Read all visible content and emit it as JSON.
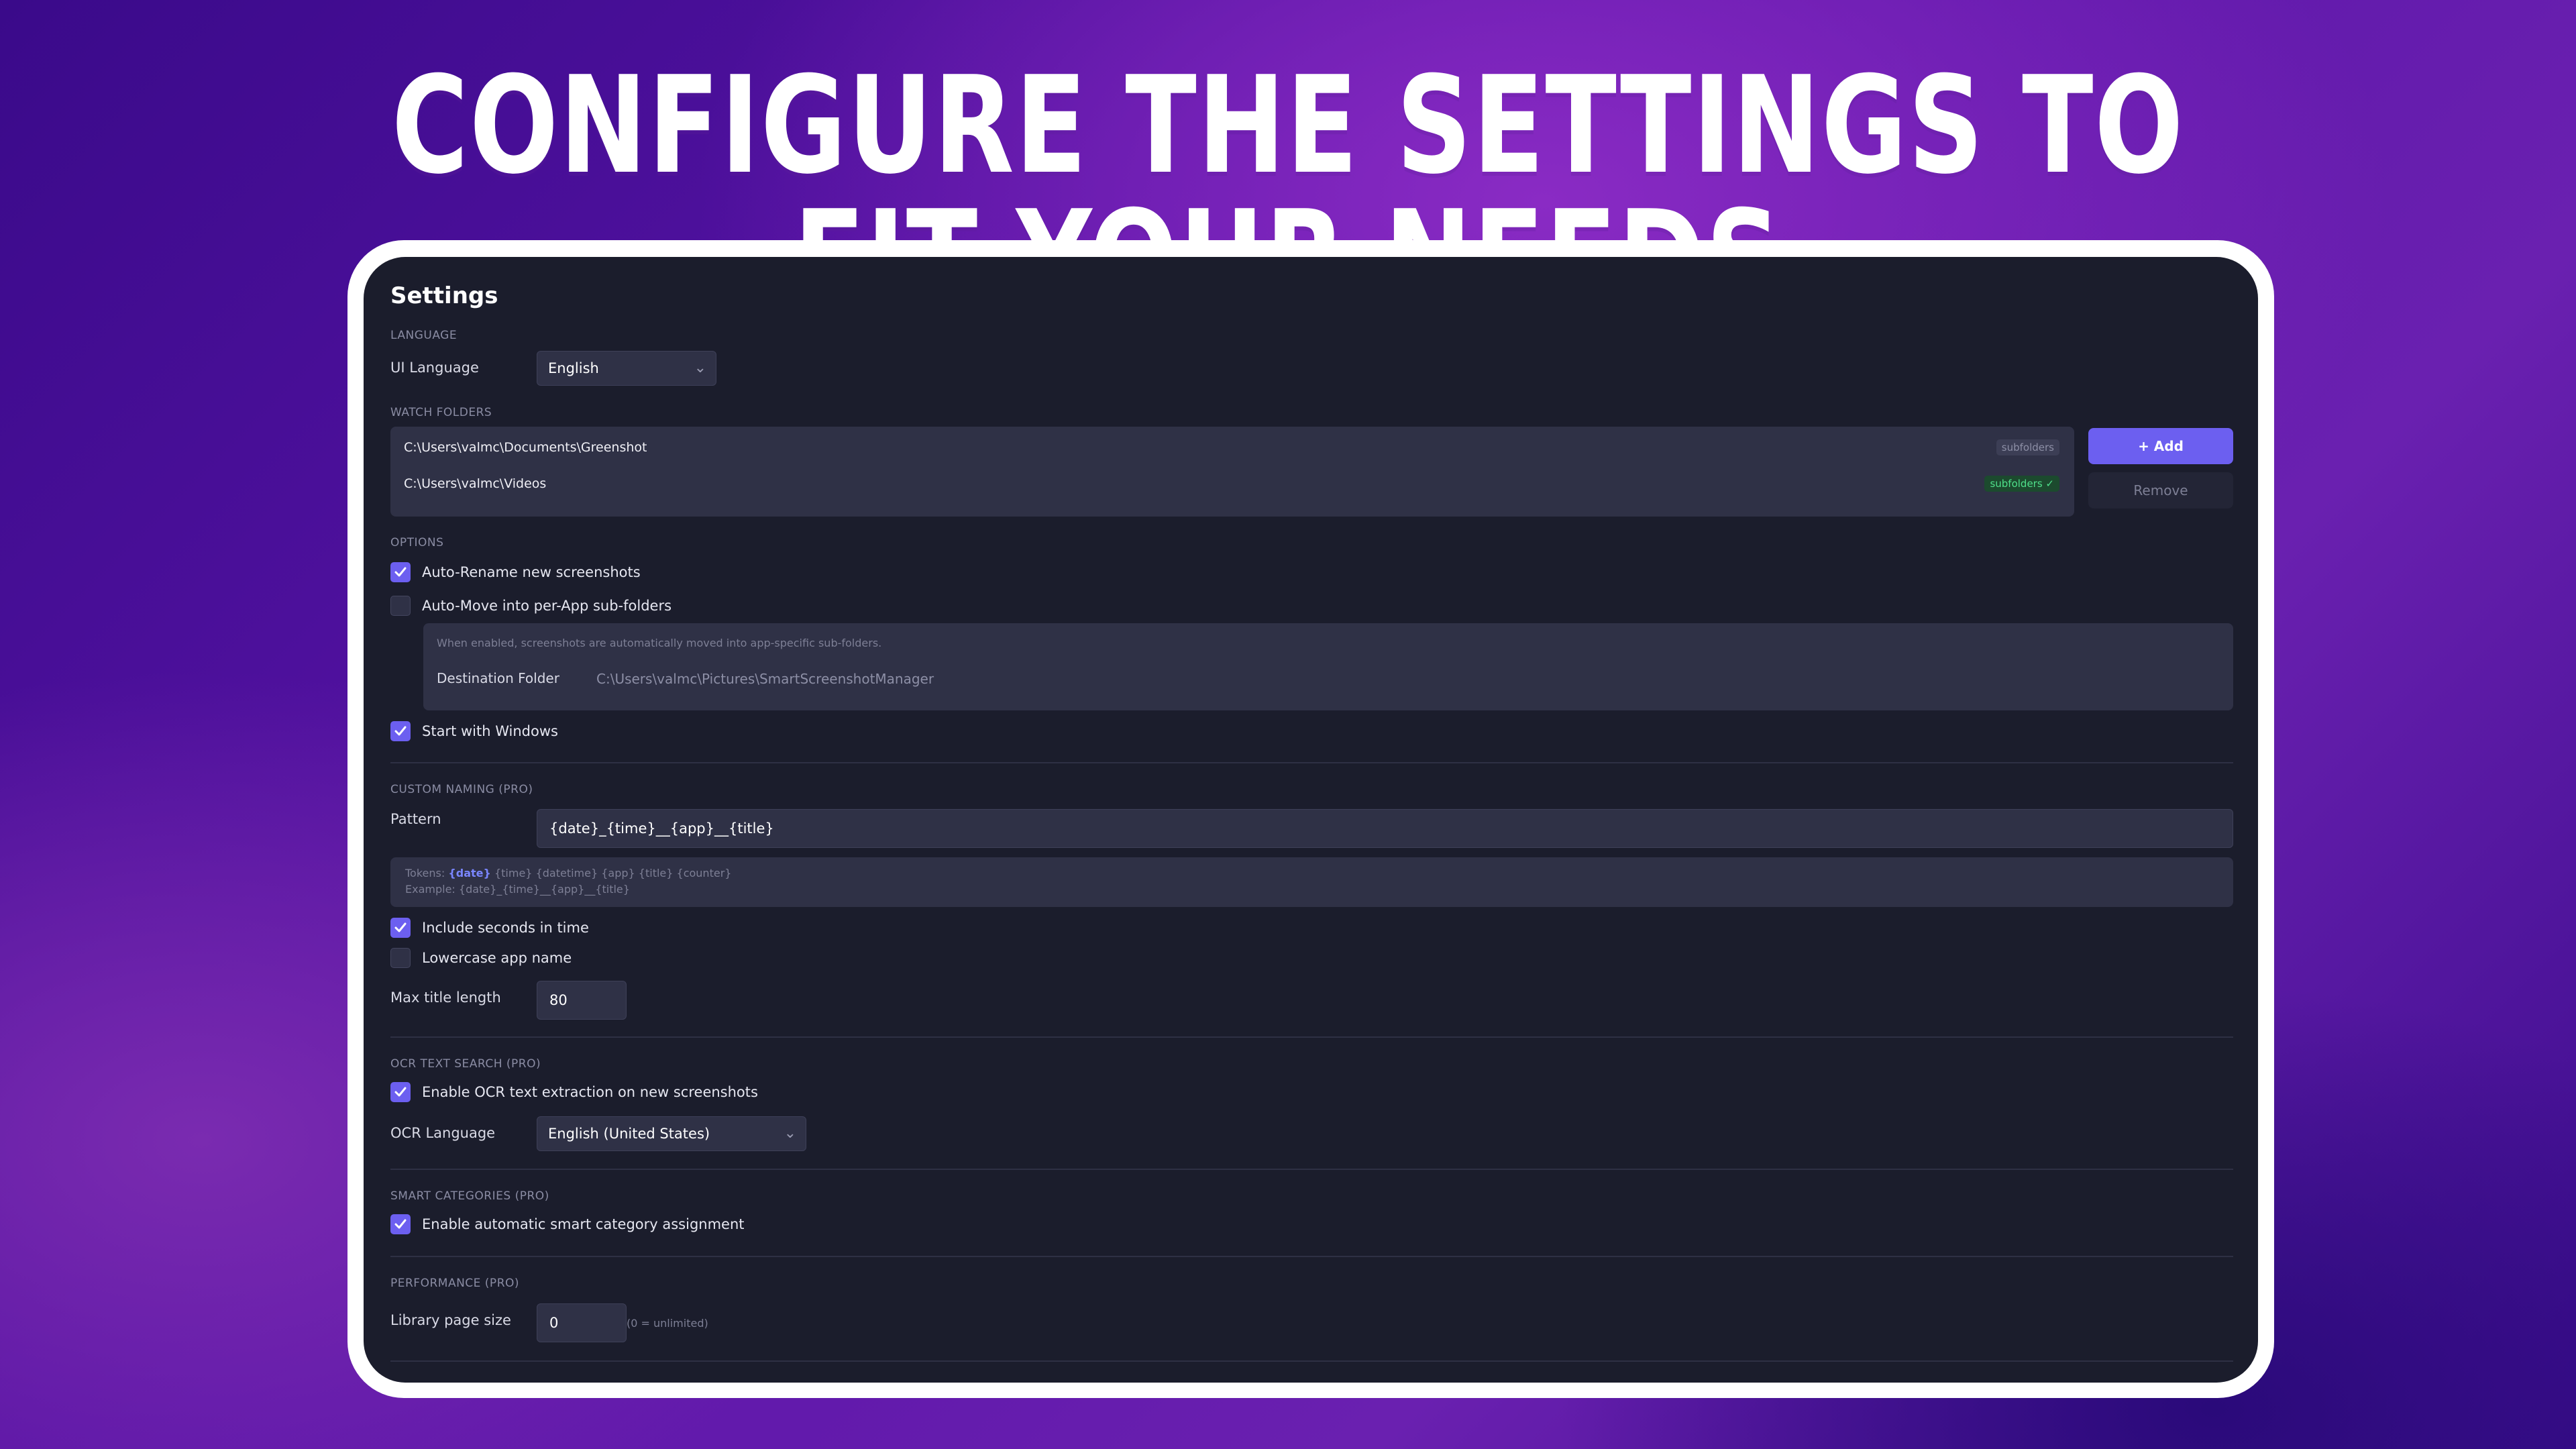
{
  "headline": "CONFIGURE THE SETTINGS TO FIT YOUR NEEDS",
  "settings": {
    "title": "Settings",
    "language": {
      "section": "LANGUAGE",
      "ui_label": "UI Language",
      "ui_value": "English"
    },
    "watch_folders": {
      "section": "WATCH FOLDERS",
      "items": [
        {
          "path": "C:\\Users\\valmc\\Documents\\Greenshot",
          "badge": "subfolders",
          "badge_state": "off"
        },
        {
          "path": "C:\\Users\\valmc\\Videos",
          "badge": "subfolders ✓",
          "badge_state": "on"
        }
      ],
      "add_label": "+ Add",
      "remove_label": "Remove"
    },
    "options": {
      "section": "OPTIONS",
      "auto_rename": {
        "label": "Auto-Rename new screenshots",
        "checked": true
      },
      "auto_move": {
        "label": "Auto-Move into per-App sub-folders",
        "checked": false
      },
      "auto_move_hint": "When enabled, screenshots are automatically moved into app-specific sub-folders.",
      "destination_label": "Destination Folder",
      "destination_value": "C:\\Users\\valmc\\Pictures\\SmartScreenshotManager",
      "start_windows": {
        "label": "Start with Windows",
        "checked": true
      }
    },
    "custom_naming": {
      "section": "CUSTOM NAMING (PRO)",
      "pattern_label": "Pattern",
      "pattern_value": "{date}_{time}__{app}__{title}",
      "tokens_prefix": "Tokens:",
      "tokens_highlight": "{date}",
      "tokens_rest": "{time} {datetime} {app} {title} {counter}",
      "example": "Example: {date}_{time}__{app}__{title}",
      "include_seconds": {
        "label": "Include seconds in time",
        "checked": true
      },
      "lowercase_app": {
        "label": "Lowercase app name",
        "checked": false
      },
      "max_title_label": "Max title length",
      "max_title_value": "80"
    },
    "ocr": {
      "section": "OCR TEXT SEARCH (PRO)",
      "enable": {
        "label": "Enable OCR text extraction on new screenshots",
        "checked": true
      },
      "language_label": "OCR Language",
      "language_value": "English (United States)"
    },
    "smart_categories": {
      "section": "SMART CATEGORIES (PRO)",
      "enable": {
        "label": "Enable automatic smart category assignment",
        "checked": true
      }
    },
    "performance": {
      "section": "PERFORMANCE (PRO)",
      "page_size_label": "Library page size",
      "page_size_value": "0",
      "page_size_hint": "(0 = unlimited)"
    }
  },
  "colors": {
    "accent": "#6c5ff0",
    "panel_bg": "#1b1d2c",
    "field_bg": "#2f3146",
    "badge_on": "#4fe08a"
  },
  "icons": [
    "chevron-down-icon",
    "check-icon"
  ]
}
